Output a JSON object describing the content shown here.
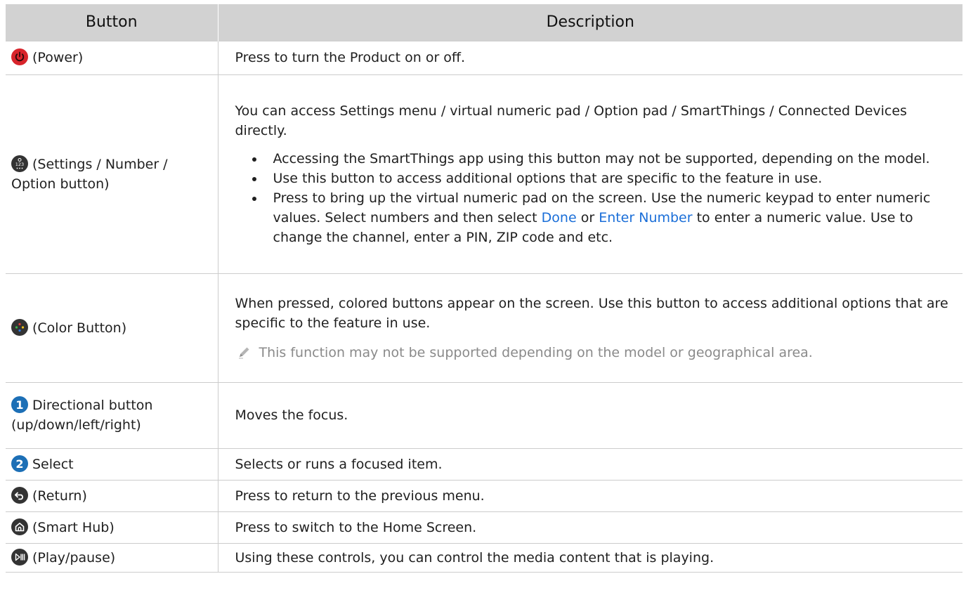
{
  "table": {
    "headers": {
      "button": "Button",
      "description": "Description"
    },
    "rows": {
      "power": {
        "icon": "power-icon",
        "label": "(Power)",
        "desc": "Press to turn the Product on or off."
      },
      "settings": {
        "icon": "settings-number-icon",
        "label": "(Settings / Number / Option button)",
        "desc": "You can access Settings menu / virtual numeric pad / Option pad / SmartThings / Connected Devices directly.",
        "bullet1": "Accessing the SmartThings app using this button may not be supported, depending on the model.",
        "bullet2": "Use this button to access additional options that are specific to the feature in use.",
        "bullet3_a": "Press to bring up the virtual numeric pad on the screen. Use the numeric keypad to enter numeric values. Select numbers and then select ",
        "bullet3_link1": "Done",
        "bullet3_b": " or ",
        "bullet3_link2": "Enter Number",
        "bullet3_c": " to enter a numeric value. Use to change the channel, enter a PIN, ZIP code and etc."
      },
      "color": {
        "icon": "color-button-icon",
        "label": "(Color Button)",
        "desc": "When pressed, colored buttons appear on the screen. Use this button to access additional options that are specific to the feature in use.",
        "note": "This function may not be supported depending on the model or geographical area."
      },
      "directional": {
        "badge": "1",
        "label": "Directional button (up/down/left/right)",
        "desc": "Moves the focus."
      },
      "select": {
        "badge": "2",
        "label": "Select",
        "desc": "Selects or runs a focused item."
      },
      "return": {
        "icon": "return-icon",
        "label": "(Return)",
        "desc": "Press to return to the previous menu."
      },
      "smarthub": {
        "icon": "home-icon",
        "label": "(Smart Hub)",
        "desc": "Press to switch to the Home Screen."
      },
      "playpause": {
        "icon": "play-pause-icon",
        "label": "(Play/pause)",
        "desc": "Using these controls, you can control the media content that is playing."
      }
    }
  },
  "colors": {
    "header_bg": "#d2d2d2",
    "link": "#1a6ed8",
    "badge": "#1c6fb6",
    "power_red": "#d8242b",
    "icon_dark": "#333333"
  }
}
